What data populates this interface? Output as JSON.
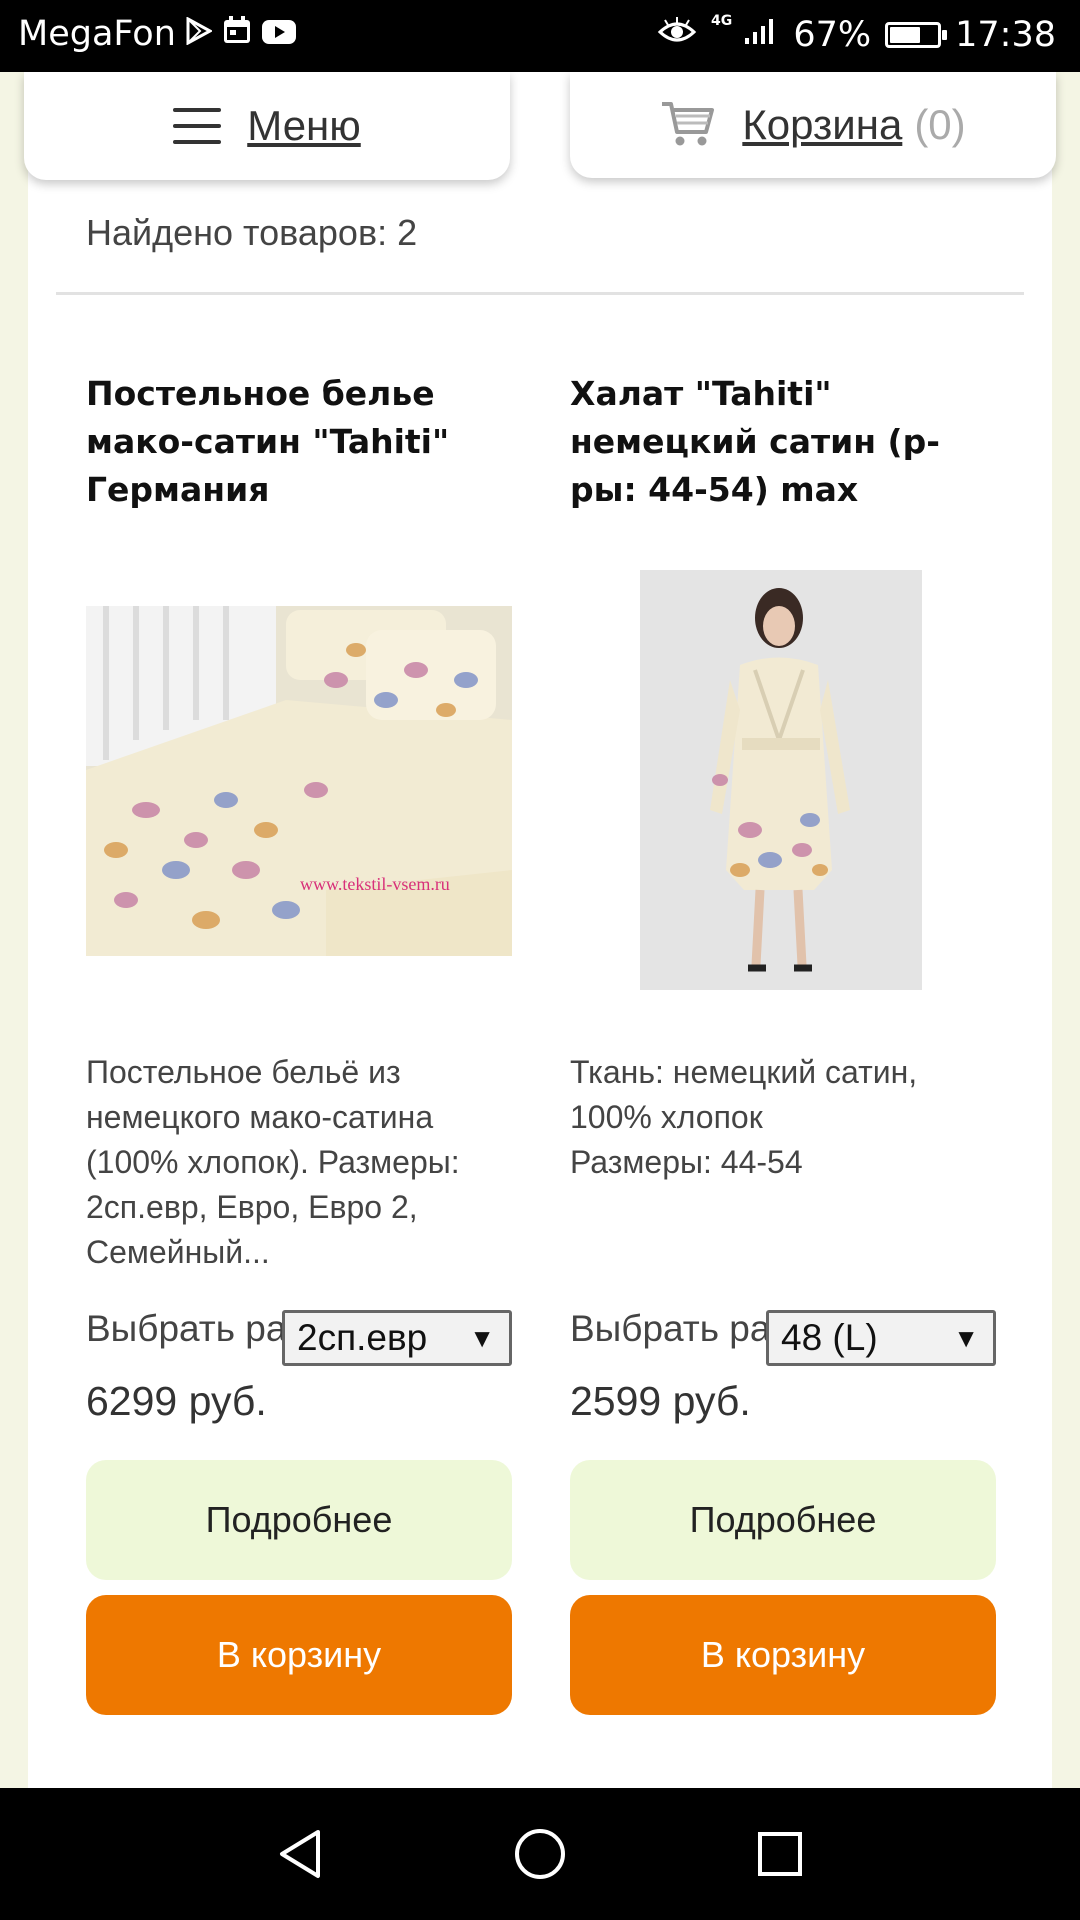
{
  "status_bar": {
    "carrier": "MegaFon",
    "network": "4G",
    "battery": "67%",
    "battery_level": 0.67,
    "time": "17:38"
  },
  "header": {
    "menu_label": "Меню",
    "cart_label": "Корзина",
    "cart_count": "(0)"
  },
  "results": {
    "found_text": "Найдено товаров: 2"
  },
  "products": [
    {
      "title": "Постельное белье мако-сатин \"Tahiti\" Германия",
      "image_watermark": "www.tekstil-vsem.ru",
      "description": "Постельное бельё из немецкого мако-сатина (100% хлопок). Размеры: 2сп.евр, Евро, Евро 2, Семейный...",
      "select_label": "Выбрать размер",
      "select_value": "2сп.евр",
      "price": "6299 руб.",
      "details_label": "Подробнее",
      "cart_button_label": "В корзину"
    },
    {
      "title": "Халат \"Tahiti\" немецкий сатин (р-ры: 44-54) max",
      "description_line1": "Ткань: немецкий сатин,",
      "description_line2": "100% хлопок",
      "description_line3": "Размеры: 44-54",
      "select_label": "Выбрать размер",
      "select_value": "48 (L)",
      "price": "2599 руб.",
      "details_label": "Подробнее",
      "cart_button_label": "В корзину"
    }
  ],
  "colors": {
    "accent_orange": "#ee7800",
    "details_button_bg": "#eef8d8",
    "page_bg": "#f4f5e4"
  }
}
